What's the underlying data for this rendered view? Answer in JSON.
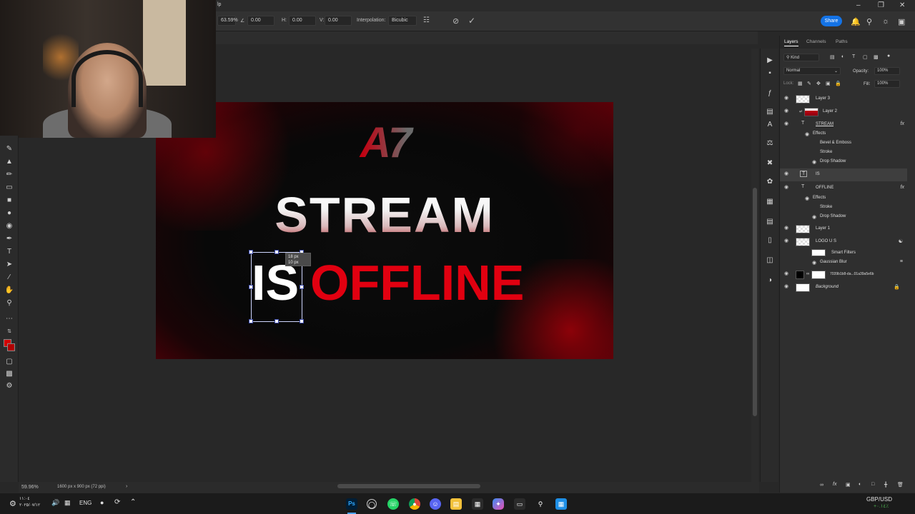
{
  "options_bar": {
    "zoom_value": "63.59%",
    "angle_value": "0.00",
    "h_label": "H:",
    "h_value": "0.00",
    "v_label": "V:",
    "v_value": "0.00",
    "interpolation_label": "Interpolation:",
    "interpolation_value": "Bicubic",
    "share_label": "Share",
    "menu_fragment": "lp"
  },
  "canvas": {
    "logo_text": "A7",
    "line1": "STREAM",
    "word_is": "IS",
    "word_offline": "OFFLINE",
    "transform_tip_w": "18 px",
    "transform_tip_h": "10 px"
  },
  "layers_panel": {
    "tabs": [
      "Layers",
      "Channels",
      "Paths"
    ],
    "filter_placeholder": "Kind",
    "blend_mode": "Normal",
    "opacity_label": "Opacity:",
    "opacity_value": "100%",
    "lock_label": "Lock:",
    "fill_label": "Fill:",
    "fill_value": "100%",
    "layers": [
      {
        "name": "Layer 3"
      },
      {
        "name": "Layer 2"
      },
      {
        "name": "STREAM"
      },
      {
        "name": "Effects"
      },
      {
        "name": "Bevel & Emboss"
      },
      {
        "name": "Stroke"
      },
      {
        "name": "Drop Shadow"
      },
      {
        "name": "IS"
      },
      {
        "name": "OFFLINE"
      },
      {
        "name": "Effects"
      },
      {
        "name": "Stroke"
      },
      {
        "name": "Drop Shadow"
      },
      {
        "name": "Layer 1"
      },
      {
        "name": "LOGO U S"
      },
      {
        "name": "Smart Filters"
      },
      {
        "name": "Gaussian Blur"
      },
      {
        "name": "7039b1b8-da...01a39a5e6b"
      },
      {
        "name": "Background"
      }
    ]
  },
  "status_bar": {
    "zoom": "59.96%",
    "doc_info": "1600 px x 900 px (72 ppi)"
  },
  "taskbar": {
    "clock": "١١:٠٤\n٢٠٢٥/٠٧/١٢",
    "language": "ENG",
    "currency": "GBP/USD",
    "currency_change": "+٠.١٤٪"
  }
}
